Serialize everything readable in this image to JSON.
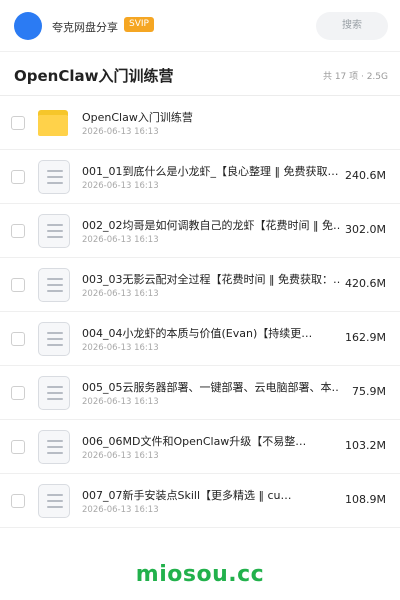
{
  "header": {
    "owner_name": "夸克网盘分享",
    "badge": "SVIP",
    "search_placeholder": "搜索"
  },
  "folder": {
    "title": "OpenClaw入门训练营",
    "meta": "共 17 项 · 2.5G"
  },
  "files": [
    {
      "type": "folder",
      "name": "OpenClaw入门训练营",
      "date": "2026-06-13 16:13",
      "size": ""
    },
    {
      "type": "file",
      "name": "001_01到底什么是小龙虾_【良心整理 ‖ 免费获取…",
      "date": "2026-06-13 16:13",
      "size": "240.6M"
    },
    {
      "type": "file",
      "name": "002_02均哥是如何调教自己的龙虾【花费时间 ‖ 免…",
      "date": "2026-06-13 16:13",
      "size": "302.0M"
    },
    {
      "type": "file",
      "name": "003_03无影云配对全过程【花费时间 ‖ 免费获取：…",
      "date": "2026-06-13 16:13",
      "size": "420.6M"
    },
    {
      "type": "file",
      "name": "004_04小龙虾的本质与价值(Evan)【持续更…",
      "date": "2026-06-13 16:13",
      "size": "162.9M"
    },
    {
      "type": "file",
      "name": "005_05云服务器部署、一键部署、云电脑部署、本…",
      "date": "2026-06-13 16:13",
      "size": "75.9M"
    },
    {
      "type": "file",
      "name": "006_06MD文件和OpenClaw升级【不易整…",
      "date": "2026-06-13 16:13",
      "size": "103.2M"
    },
    {
      "type": "file",
      "name": "007_07新手安装点Skill【更多精选 ‖ cu…",
      "date": "2026-06-13 16:13",
      "size": "108.9M"
    }
  ],
  "watermark": "miosou.cc",
  "colors": {
    "avatar": "#2b7bf3",
    "badge": "#f5a623",
    "folder": "#ffd24a",
    "watermark": "#22b14c"
  }
}
